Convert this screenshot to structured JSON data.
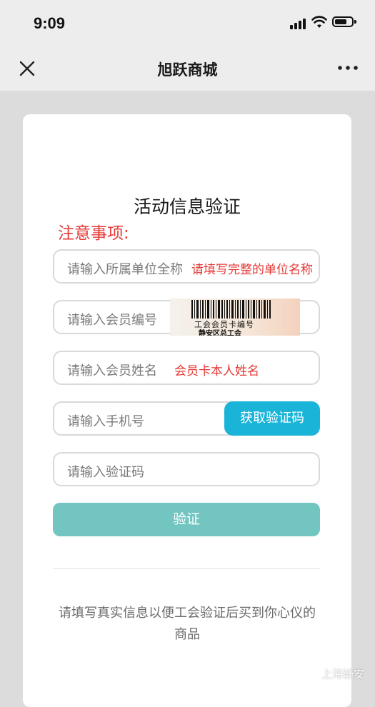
{
  "status_bar": {
    "time": "9:09",
    "signal_icon": "signal-bars-icon",
    "wifi_icon": "wifi-icon",
    "battery_icon": "battery-icon"
  },
  "nav": {
    "title": "旭跃商城",
    "close_icon": "close-icon",
    "more_icon": "more-dots-icon"
  },
  "form": {
    "title": "活动信息验证",
    "notice": "注意事项:",
    "fields": {
      "org": {
        "placeholder": "请输入所属单位全称",
        "hint": "请填写完整的单位名称"
      },
      "member_no": {
        "placeholder": "请输入会员编号"
      },
      "member_name": {
        "placeholder": "请输入会员姓名",
        "hint": "会员卡本人姓名"
      },
      "phone": {
        "placeholder": "请输入手机号"
      },
      "code": {
        "placeholder": "请输入验证码"
      }
    },
    "get_code_button": "获取验证码",
    "verify_button": "验证",
    "footer_note": "请填写真实信息以便工会验证后买到你心仪的商品"
  },
  "barcode_image": {
    "label": "工会会员卡编号",
    "issuer": "静安区总工会"
  },
  "watermark": {
    "text": "上海静安"
  },
  "colors": {
    "accent_red": "#e53935",
    "code_button": "#1ab4d8",
    "verify_button": "#72c5c0"
  }
}
